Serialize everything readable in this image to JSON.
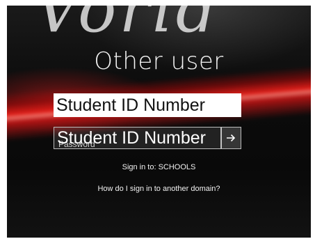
{
  "logo_text": "Vorld",
  "title": "Other user",
  "username_field": {
    "value": "Student ID Number"
  },
  "password_field": {
    "placeholder": "Password",
    "value": "Student ID Number"
  },
  "submit_button": {
    "icon": "arrow-right-icon"
  },
  "signin_to": "Sign in to: SCHOOLS",
  "other_domain_link": "How do I sign in to another domain?"
}
